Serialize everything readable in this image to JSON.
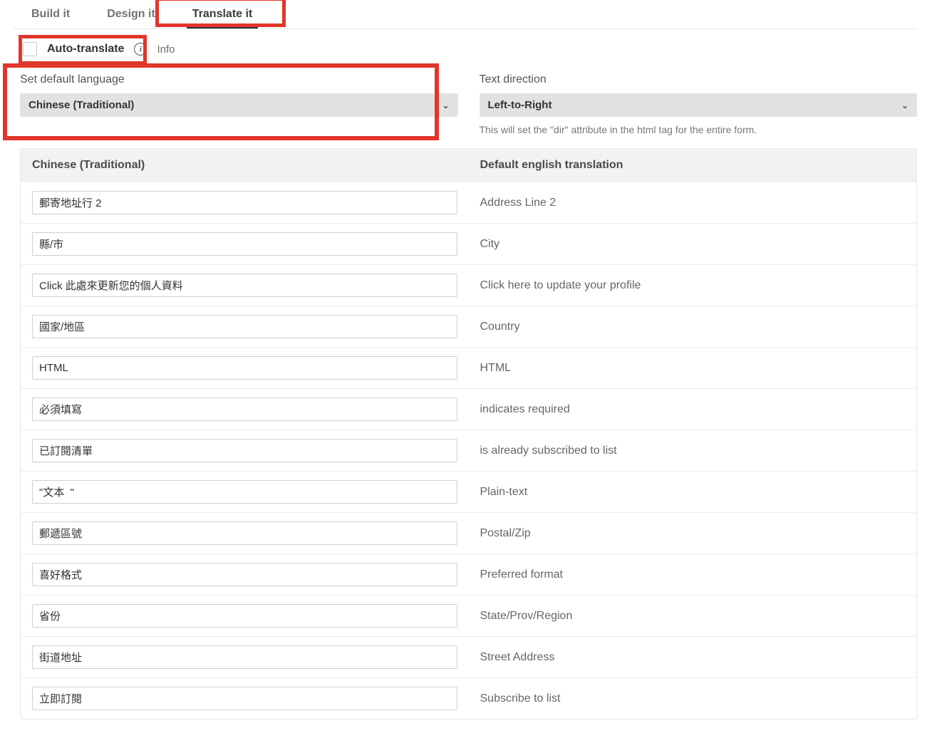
{
  "tabs": {
    "build": "Build it",
    "design": "Design it",
    "translate": "Translate it",
    "active": "translate"
  },
  "options": {
    "auto_translate_label": "Auto-translate",
    "info_label": "Info"
  },
  "settings": {
    "language_label": "Set default language",
    "language_value": "Chinese (Traditional)",
    "direction_label": "Text direction",
    "direction_value": "Left-to-Right",
    "direction_helper": "This will set the \"dir\" attribute in the html tag for the entire form."
  },
  "table": {
    "header_translated": "Chinese (Traditional)",
    "header_default": "Default english translation",
    "rows": [
      {
        "translated": "郵寄地址行 2",
        "default": "Address Line 2"
      },
      {
        "translated": "縣/市",
        "default": "City"
      },
      {
        "translated": "Click 此處來更新您的個人資料",
        "default": "Click here to update your profile"
      },
      {
        "translated": "國家/地區",
        "default": "Country"
      },
      {
        "translated": "HTML",
        "default": "HTML"
      },
      {
        "translated": "必須填寫",
        "default": "indicates required"
      },
      {
        "translated": "已訂閱清單",
        "default": "is already subscribed to list"
      },
      {
        "translated": "\"文本  \"",
        "default": "Plain-text"
      },
      {
        "translated": "郵遞區號",
        "default": "Postal/Zip"
      },
      {
        "translated": "喜好格式",
        "default": "Preferred format"
      },
      {
        "translated": "省份",
        "default": "State/Prov/Region"
      },
      {
        "translated": "街道地址",
        "default": "Street Address"
      },
      {
        "translated": "立即訂閱",
        "default": "Subscribe to list"
      }
    ]
  }
}
